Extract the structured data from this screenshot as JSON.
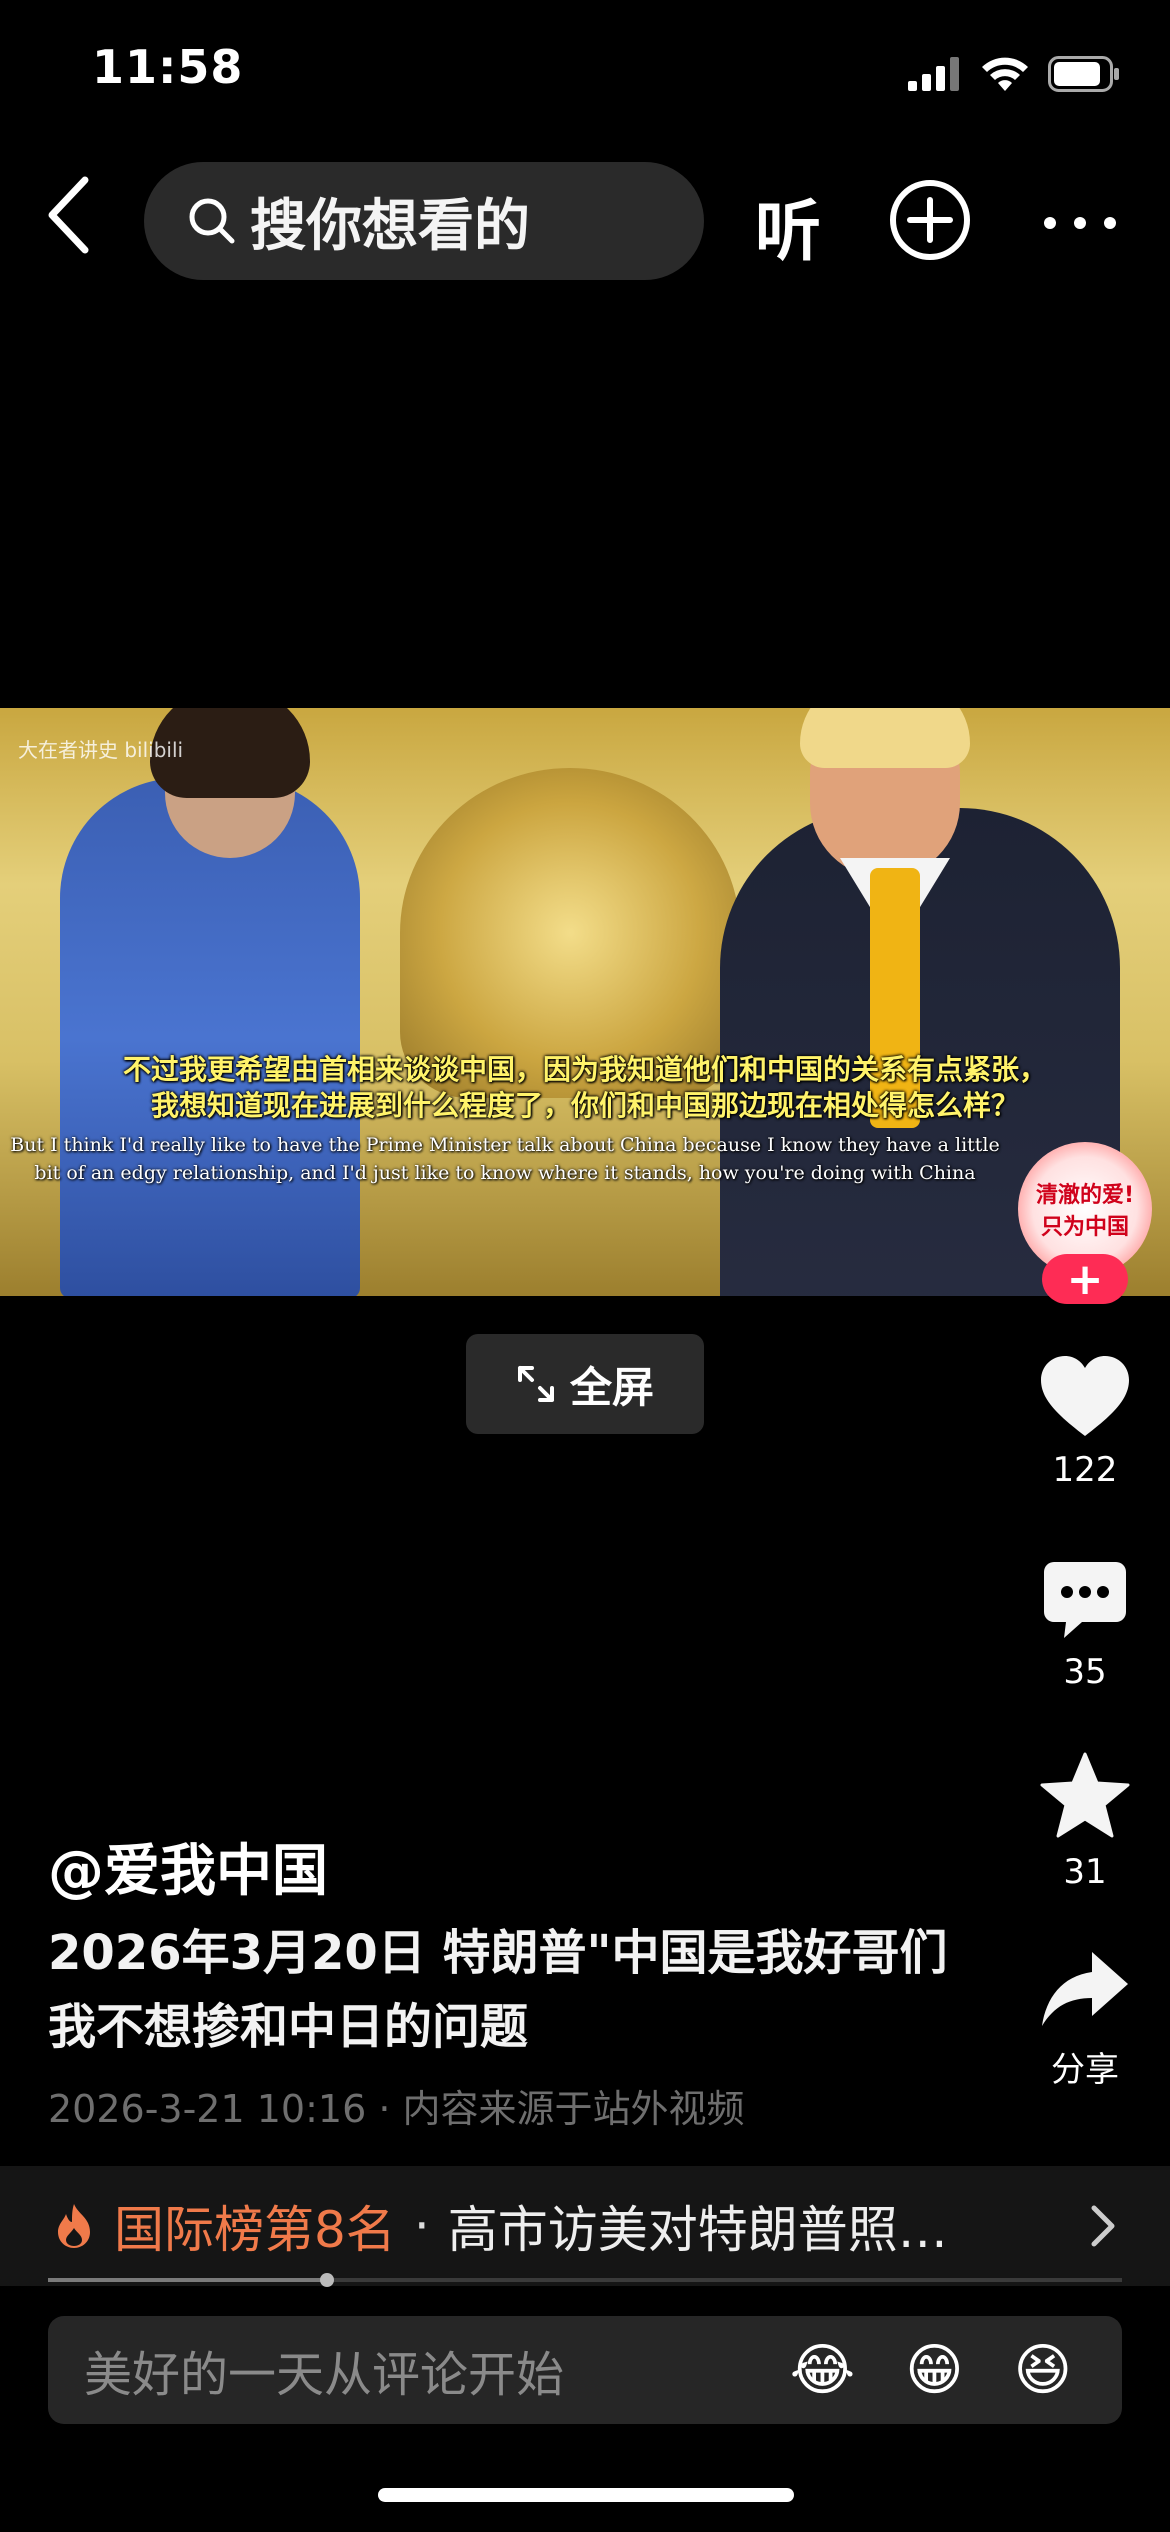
{
  "status_bar": {
    "time": "11:58"
  },
  "nav": {
    "search_placeholder": "搜你想看的",
    "listen_label": "听"
  },
  "video": {
    "watermark": "大在者讲史 bilibili",
    "subtitle_zh_1": "不过我更希望由首相来谈谈中国，因为我知道他们和中国的关系有点紧张，",
    "subtitle_zh_2": "我想知道现在进展到什么程度了，你们和中国那边现在相处得怎么样？",
    "subtitle_en_1": "But I think I'd really like to have the Prime Minister talk about China because I know they have a little",
    "subtitle_en_2": "bit of an edgy relationship, and I'd just like to know where it stands, how you're doing with China",
    "fullscreen_label": "全屏"
  },
  "avatar_badge": {
    "line1": "清澈的爱!",
    "line2": "只为中国",
    "follow": "+"
  },
  "actions": {
    "likes": "122",
    "comments": "35",
    "favorites": "31",
    "share_label": "分享"
  },
  "post": {
    "author": "@爱我中国",
    "title": "2026年3月20日 特朗普\"中国是我好哥们 我不想掺和中日的问题",
    "meta": "2026-3-21 10:16 · 内容来源于站外视频"
  },
  "ranking": {
    "label": "国际榜第8名",
    "separator": "·",
    "topic": "高市访美对特朗普照…"
  },
  "progress": 0.26,
  "comment_bar": {
    "placeholder": "美好的一天从评论开始",
    "emoji_1": "😂",
    "emoji_2": "😁",
    "emoji_3": "😆"
  }
}
